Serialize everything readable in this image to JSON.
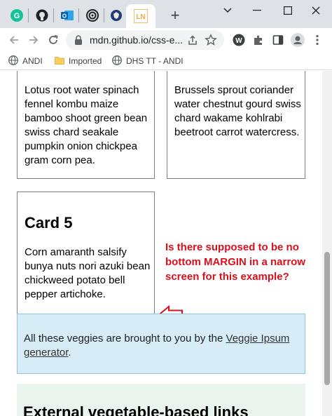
{
  "browser": {
    "tabs": [
      {
        "icon": "grammarly-icon"
      },
      {
        "icon": "github-icon"
      },
      {
        "icon": "outlook-icon"
      },
      {
        "icon": "target-icon"
      },
      {
        "icon": "dhs-seal-icon"
      },
      {
        "icon": "ln-icon",
        "text": "LN"
      }
    ],
    "new_tab": "+",
    "address": "mdn.github.io/css-e..."
  },
  "bookmarks": [
    {
      "label": "ANDI"
    },
    {
      "label": "Imported"
    },
    {
      "label": "DHS TT - ANDI"
    }
  ],
  "page": {
    "card3_text": "Lotus root water spinach fennel kombu maize bamboo shoot green bean swiss chard seakale pumpkin onion chickpea gram corn pea.",
    "card4_text": "Brussels sprout coriander water chestnut gourd swiss chard wakame kohlrabi beetroot carrot watercress.",
    "card5_title": "Card 5",
    "card5_text": "Corn amaranth salsify bunya nuts nori azuki bean chickweed potato bell pepper artichoke.",
    "annotation": "Is there supposed to be no bottom MARGIN in a narrow screen for this example?",
    "footer_prefix": "All these veggies are brought to you by the ",
    "footer_link": "Veggie Ipsum generator",
    "footer_suffix": ".",
    "links_title": "External vegetable-based links"
  },
  "colors": {
    "annotation": "#d9101b",
    "footer_bg": "#d6ecf6",
    "links_bg": "#e8f4ec"
  }
}
